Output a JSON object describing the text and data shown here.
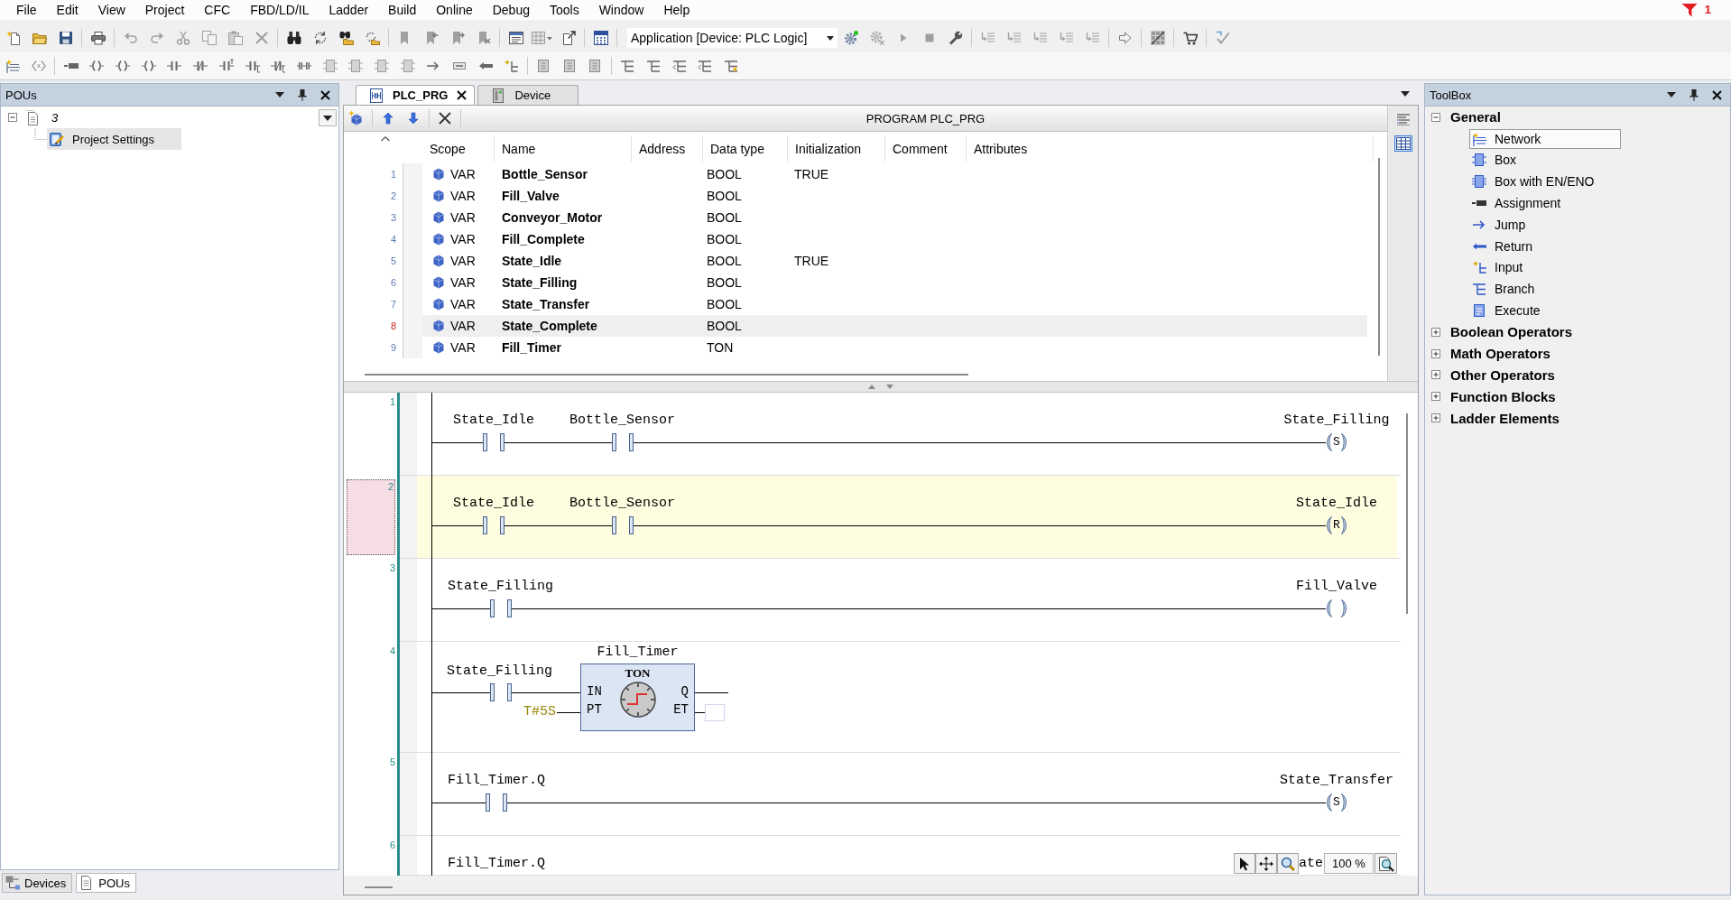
{
  "menu": [
    "File",
    "Edit",
    "View",
    "Project",
    "CFC",
    "FBD/LD/IL",
    "Ladder",
    "Build",
    "Online",
    "Debug",
    "Tools",
    "Window",
    "Help"
  ],
  "toolbar": {
    "application_selector": "Application [Device: PLC Logic]"
  },
  "message_indicator": {
    "count": "1"
  },
  "pous_panel": {
    "title": "POUs",
    "tree": [
      {
        "label": "3",
        "expanded": true,
        "selected": false,
        "children": [
          {
            "label": "Project Settings",
            "selected": true
          }
        ]
      }
    ],
    "bottom_tabs": [
      {
        "label": "Devices",
        "selected": false
      },
      {
        "label": "POUs",
        "selected": true
      }
    ]
  },
  "editor": {
    "tabs": [
      {
        "label": "PLC_PRG",
        "selected": true
      },
      {
        "label": "Device",
        "selected": false
      }
    ],
    "declaration": {
      "title": "PROGRAM PLC_PRG",
      "view_modes": [
        {
          "selected": false
        },
        {
          "selected": true
        }
      ],
      "columns": [
        "Scope",
        "Name",
        "Address",
        "Data type",
        "Initialization",
        "Comment",
        "Attributes"
      ],
      "rows": [
        {
          "line": "1",
          "scope": "VAR",
          "name": "Bottle_Sensor",
          "data_type": "BOOL",
          "initialization": "TRUE",
          "selected": false
        },
        {
          "line": "2",
          "scope": "VAR",
          "name": "Fill_Valve",
          "data_type": "BOOL",
          "selected": false
        },
        {
          "line": "3",
          "scope": "VAR",
          "name": "Conveyor_Motor",
          "data_type": "BOOL",
          "selected": false
        },
        {
          "line": "4",
          "scope": "VAR",
          "name": "Fill_Complete",
          "data_type": "BOOL",
          "selected": false
        },
        {
          "line": "5",
          "scope": "VAR",
          "name": "State_Idle",
          "data_type": "BOOL",
          "initialization": "TRUE",
          "selected": false
        },
        {
          "line": "6",
          "scope": "VAR",
          "name": "State_Filling",
          "data_type": "BOOL",
          "selected": false
        },
        {
          "line": "7",
          "scope": "VAR",
          "name": "State_Transfer",
          "data_type": "BOOL",
          "selected": false
        },
        {
          "line": "8",
          "scope": "VAR",
          "name": "State_Complete",
          "data_type": "BOOL",
          "selected": true
        },
        {
          "line": "9",
          "scope": "VAR",
          "name": "Fill_Timer",
          "data_type": "TON",
          "selected": false
        }
      ]
    },
    "ladder": {
      "networks": [
        {
          "number": "1",
          "kind": "coil",
          "selected": false,
          "contacts": [
            "State_Idle",
            "Bottle_Sensor"
          ],
          "coil": {
            "name": "State_Filling",
            "modifier": "S"
          }
        },
        {
          "number": "2",
          "kind": "coil",
          "selected": true,
          "contacts": [
            "State_Idle",
            "Bottle_Sensor"
          ],
          "coil": {
            "name": "State_Idle",
            "modifier": "R"
          }
        },
        {
          "number": "3",
          "kind": "coil",
          "selected": false,
          "contacts": [
            "State_Filling"
          ],
          "coil": {
            "name": "Fill_Valve"
          }
        },
        {
          "number": "4",
          "kind": "block",
          "selected": false,
          "contacts": [
            "State_Filling"
          ],
          "block": {
            "instance": "Fill_Timer",
            "type": "TON",
            "inputs": [
              "IN",
              "PT"
            ],
            "outputs": [
              "Q",
              "ET"
            ],
            "pt_input": "T#5S"
          }
        },
        {
          "number": "5",
          "kind": "coil",
          "selected": false,
          "contacts": [
            "Fill_Timer.Q"
          ],
          "coil": {
            "name": "State_Transfer",
            "modifier": "S"
          }
        },
        {
          "number": "6",
          "kind": "cut",
          "selected": false,
          "contacts": [
            "Fill_Timer.Q"
          ],
          "coil": {
            "name": "ate"
          }
        }
      ],
      "zoom_level": "100 %"
    }
  },
  "toolbox": {
    "title": "ToolBox",
    "groups": [
      {
        "label": "General",
        "expanded": true,
        "items": [
          {
            "label": "Network",
            "selected": true
          },
          {
            "label": "Box",
            "selected": false
          },
          {
            "label": "Box with EN/ENO",
            "selected": false
          },
          {
            "label": "Assignment",
            "selected": false
          },
          {
            "label": "Jump",
            "selected": false
          },
          {
            "label": "Return",
            "selected": false
          },
          {
            "label": "Input",
            "selected": false
          },
          {
            "label": "Branch",
            "selected": false
          },
          {
            "label": "Execute",
            "selected": false
          }
        ]
      },
      {
        "label": "Boolean Operators",
        "expanded": false
      },
      {
        "label": "Math Operators",
        "expanded": false
      },
      {
        "label": "Other Operators",
        "expanded": false
      },
      {
        "label": "Function Blocks",
        "expanded": false
      },
      {
        "label": "Ladder Elements",
        "expanded": false
      }
    ]
  }
}
